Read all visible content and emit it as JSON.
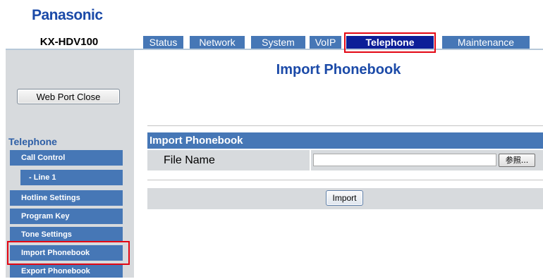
{
  "brand": {
    "logo": "Panasonic",
    "model": "KX-HDV100"
  },
  "tabs": [
    {
      "label": "Status",
      "active": false
    },
    {
      "label": "Network",
      "active": false
    },
    {
      "label": "System",
      "active": false
    },
    {
      "label": "VoIP",
      "active": false
    },
    {
      "label": "Telephone",
      "active": true
    },
    {
      "label": "Maintenance",
      "active": false
    }
  ],
  "sidebar": {
    "web_port_close_label": "Web Port Close",
    "section_title": "Telephone",
    "items": [
      {
        "label": "Call Control"
      },
      {
        "label": "- Line 1"
      },
      {
        "label": "Hotline Settings"
      },
      {
        "label": "Program Key"
      },
      {
        "label": "Tone Settings"
      },
      {
        "label": "Import Phonebook"
      },
      {
        "label": "Export Phonebook"
      }
    ]
  },
  "main": {
    "page_title": "Import Phonebook",
    "section_title": "Import Phonebook",
    "file_name_label": "File Name",
    "file_name_value": "",
    "browse_label": "参照...",
    "import_label": "Import"
  },
  "colors": {
    "logo": "#1b4aa8",
    "tab": "#4677b6",
    "tab_active": "#0c1e98",
    "panel": "#d7dadd",
    "highlight": "#e30613"
  }
}
